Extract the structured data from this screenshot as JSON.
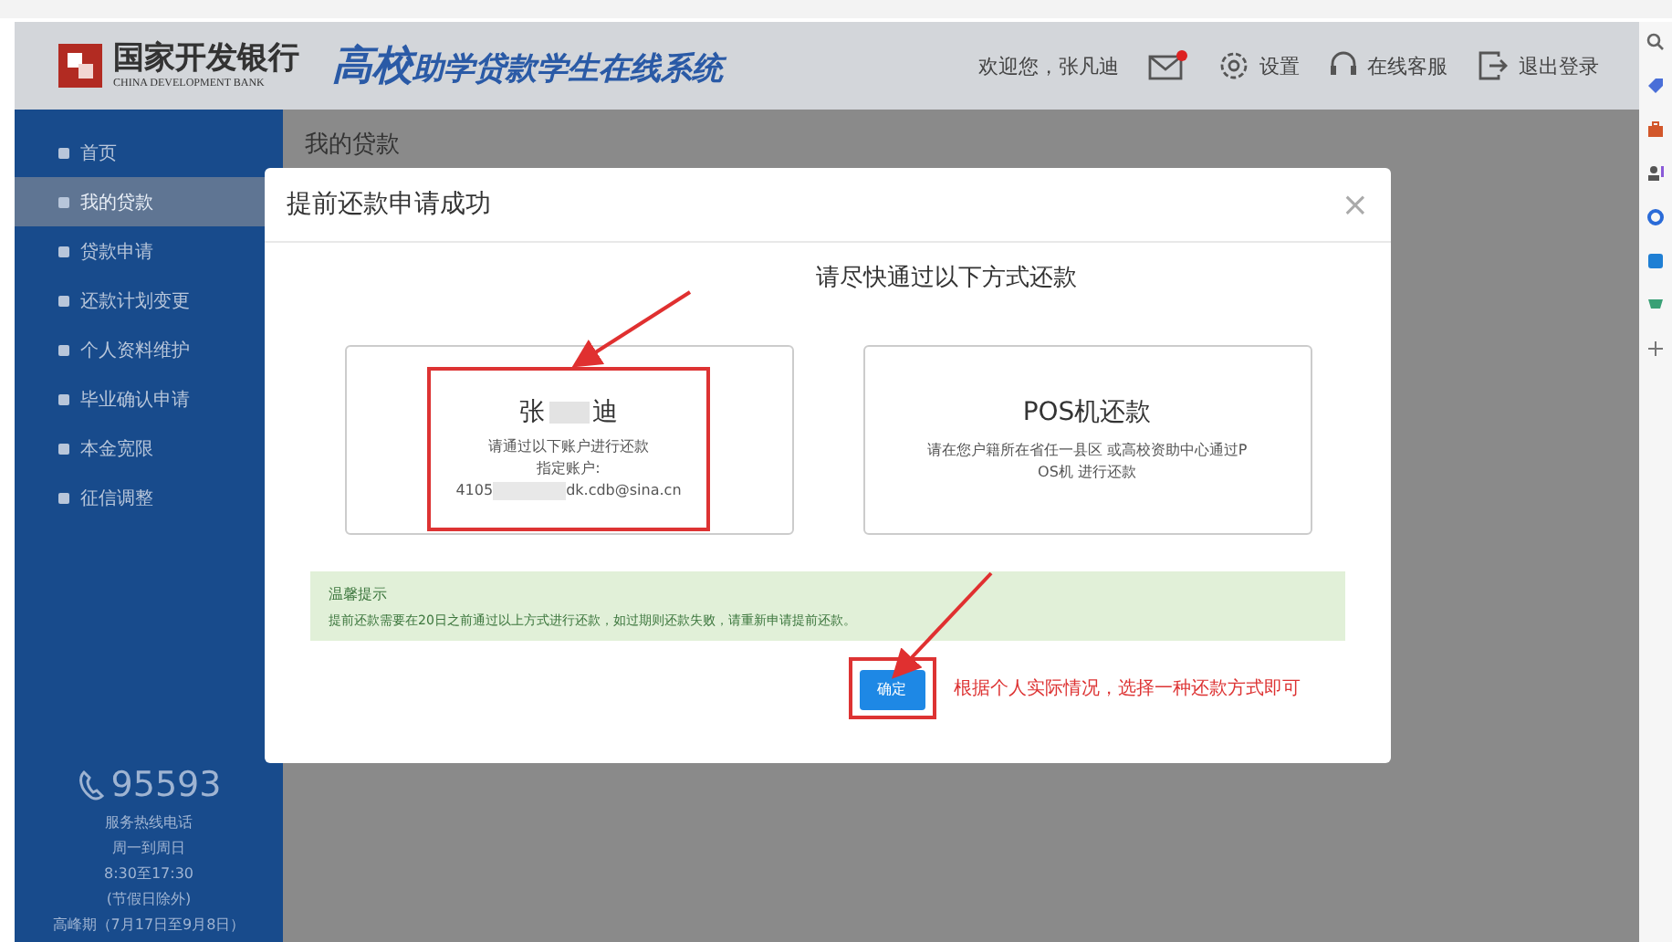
{
  "header": {
    "bank_name": "国家开发银行",
    "bank_name_en": "CHINA DEVELOPMENT BANK",
    "system_title_big": "高校",
    "system_title": "助学贷款学生在线系统",
    "welcome": "欢迎您，张凡迪",
    "mail_unread": true,
    "settings": "设置",
    "service": "在线客服",
    "logout": "退出登录"
  },
  "sidebar": {
    "items": [
      {
        "label": "首页",
        "selected": false
      },
      {
        "label": "我的贷款",
        "selected": true
      },
      {
        "label": "贷款申请",
        "selected": false
      },
      {
        "label": "还款计划变更",
        "selected": false
      },
      {
        "label": "个人资料维护",
        "selected": false
      },
      {
        "label": "毕业确认申请",
        "selected": false
      },
      {
        "label": "本金宽限",
        "selected": false
      },
      {
        "label": "征信调整",
        "selected": false
      }
    ],
    "hotline": "95593",
    "hotline_lines": [
      "服务热线电话",
      "周一到周日",
      "8:30至17:30",
      "(节假日除外)",
      "高峰期（7月17日至9月8日）"
    ]
  },
  "page_title": "我的贷款",
  "dialog": {
    "title": "提前还款申请成功",
    "close": "×",
    "subtitle": "请尽快通过以下方式还款",
    "options": [
      {
        "kind": "account",
        "name_first": "张",
        "name_last": "迪",
        "lines": [
          "请通过以下账户进行还款",
          "指定账户:"
        ],
        "account_start": "4105",
        "account_end": "dk.cdb@sina.cn"
      },
      {
        "kind": "pos",
        "name": "POS机还款",
        "lines": [
          "请在您户籍所在省任一县区 或高校资助中心通过P",
          "OS机 进行还款"
        ]
      }
    ],
    "tip_title": "温馨提示",
    "tip_text": "提前还款需要在20日之前通过以上方式进行还款，如过期则还款失败，请重新申请提前还款。",
    "confirm": "确定",
    "note": "根据个人实际情况，选择一种还款方式即可"
  }
}
